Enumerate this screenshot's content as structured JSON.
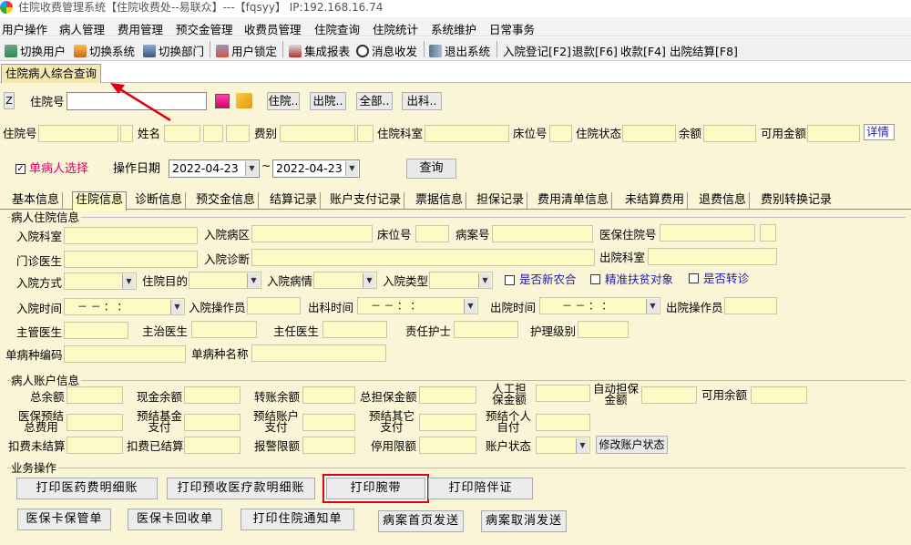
{
  "window": {
    "title": "住院收费管理系统【住院收费处--易联众】---【fqsyy】 IP:192.168.16.74"
  },
  "menu": [
    "用户操作",
    "病人管理",
    "费用管理",
    "预交金管理",
    "收费员管理",
    "住院查询",
    "住院统计",
    "系统维护",
    "日常事务"
  ],
  "toolbar": [
    {
      "label": "切换用户",
      "icon": "user-switch-icon"
    },
    {
      "label": "切换系统",
      "icon": "system-switch-icon"
    },
    {
      "label": "切换部门",
      "icon": "dept-switch-icon"
    },
    {
      "label": "用户锁定",
      "icon": "lock-icon"
    },
    {
      "label": "集成报表",
      "icon": "report-icon"
    },
    {
      "label": "消息收发",
      "icon": "message-icon"
    },
    {
      "label": "退出系统",
      "icon": "exit-icon"
    },
    {
      "label": "入院登记[F2]"
    },
    {
      "label": "退款[F6]"
    },
    {
      "label": "收款[F4]"
    },
    {
      "label": "出院结算[F8]"
    }
  ],
  "main_tab": "住院病人综合查询",
  "search": {
    "z_button": "Z",
    "hosp_no_label": "住院号",
    "hosp_no_value": "",
    "filter_buttons": [
      "住院..",
      "出院..",
      "全部..",
      "出科.."
    ]
  },
  "info_row": {
    "labels": [
      "住院号",
      "姓名",
      "费别",
      "住院科室",
      "床位号",
      "住院状态",
      "余额",
      "可用金额"
    ],
    "detail_link": "详情"
  },
  "options": {
    "single_patient_label": "单病人选择",
    "single_patient_checked": true,
    "op_date_label": "操作日期",
    "date_from": "2022-04-23",
    "range_sep": "~",
    "date_to": "2022-04-23",
    "query_button": "查询"
  },
  "tabs": [
    "基本信息",
    "住院信息",
    "诊断信息",
    "预交金信息",
    "结算记录",
    "账户支付记录",
    "票据信息",
    "担保记录",
    "费用清单信息",
    "未结算费用",
    "退费信息",
    "费别转换记录"
  ],
  "active_tab": 1,
  "patient_info": {
    "title": "病人住院信息",
    "ward_label": "入院科室",
    "area_label": "入院病区",
    "bed_label": "床位号",
    "case_label": "病案号",
    "insurance_no_label": "医保住院号",
    "clinic_doc_label": "门诊医生",
    "admit_diag_label": "入院诊断",
    "discharge_dept_label": "出院科室",
    "admit_way_label": "入院方式",
    "purpose_label": "住院目的",
    "condition_label": "入院病情",
    "admit_type_label": "入院类型",
    "new_rural_label": "是否新农合",
    "poverty_label": "精准扶贫对象",
    "transfer_label": "是否转诊",
    "admit_time_label": "入院时间",
    "admit_operator_label": "入院操作员",
    "leave_dept_time_label": "出科时间",
    "discharge_time_label": "出院时间",
    "discharge_operator_label": "出院操作员",
    "time_placeholder": "－ －   ： ：",
    "chief_doc_label": "主管医生",
    "attend_doc_label": "主治医生",
    "director_doc_label": "主任医生",
    "nurse_label": "责任护士",
    "care_level_label": "护理级别",
    "disease_code_label": "单病种编码",
    "disease_name_label": "单病种名称"
  },
  "account": {
    "title": "病人账户信息",
    "total_label": "总余额",
    "cash_label": "现金余额",
    "transfer_label": "转账余额",
    "guarantee_label": "总担保金额",
    "manual_guarantee_label": "人工担保金额",
    "auto_guarantee_label": "自动担保金额",
    "available_label": "可用余额",
    "ins_total_label": "医保预结总费用",
    "fund_label": "预结基金支付",
    "acct_pay_label": "预结账户支付",
    "other_pay_label": "预结其它支付",
    "self_pay_label": "预结个人自付",
    "unsettled_label": "扣费未结算",
    "settled_label": "扣费已结算",
    "alarm_label": "报警限额",
    "stop_label": "停用限额",
    "status_label": "账户状态",
    "modify_button": "修改账户状态"
  },
  "ops": {
    "title": "业务操作",
    "buttons_row1": [
      "打印医药费明细账",
      "打印预收医疗款明细账",
      "打印腕带",
      "打印陪伴证"
    ],
    "buttons_row2": [
      "医保卡保管单",
      "医保卡回收单",
      "打印住院通知单",
      "病案首页发送",
      "病案取消发送"
    ]
  },
  "colors": {
    "field": "#fdfac6",
    "panel": "#fbf5d7",
    "highlight": "#e0000f",
    "accent_text": "#d7006a"
  }
}
